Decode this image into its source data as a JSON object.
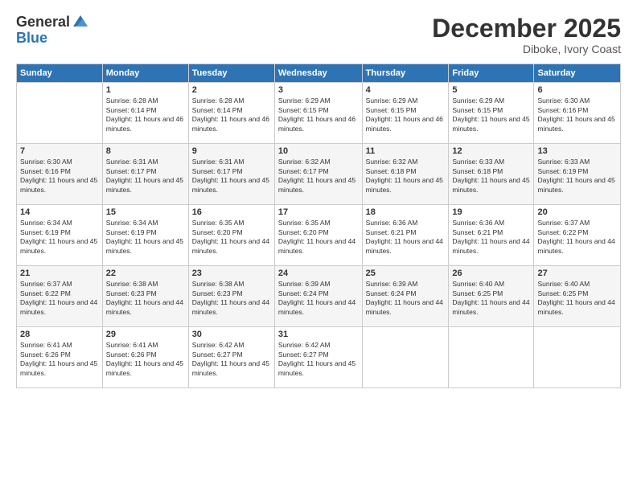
{
  "logo": {
    "general": "General",
    "blue": "Blue"
  },
  "header": {
    "month": "December 2025",
    "location": "Diboke, Ivory Coast"
  },
  "days": [
    "Sunday",
    "Monday",
    "Tuesday",
    "Wednesday",
    "Thursday",
    "Friday",
    "Saturday"
  ],
  "weeks": [
    [
      {
        "date": "",
        "sunrise": "",
        "sunset": "",
        "daylight": ""
      },
      {
        "date": "1",
        "sunrise": "Sunrise: 6:28 AM",
        "sunset": "Sunset: 6:14 PM",
        "daylight": "Daylight: 11 hours and 46 minutes."
      },
      {
        "date": "2",
        "sunrise": "Sunrise: 6:28 AM",
        "sunset": "Sunset: 6:14 PM",
        "daylight": "Daylight: 11 hours and 46 minutes."
      },
      {
        "date": "3",
        "sunrise": "Sunrise: 6:29 AM",
        "sunset": "Sunset: 6:15 PM",
        "daylight": "Daylight: 11 hours and 46 minutes."
      },
      {
        "date": "4",
        "sunrise": "Sunrise: 6:29 AM",
        "sunset": "Sunset: 6:15 PM",
        "daylight": "Daylight: 11 hours and 46 minutes."
      },
      {
        "date": "5",
        "sunrise": "Sunrise: 6:29 AM",
        "sunset": "Sunset: 6:15 PM",
        "daylight": "Daylight: 11 hours and 45 minutes."
      },
      {
        "date": "6",
        "sunrise": "Sunrise: 6:30 AM",
        "sunset": "Sunset: 6:16 PM",
        "daylight": "Daylight: 11 hours and 45 minutes."
      }
    ],
    [
      {
        "date": "7",
        "sunrise": "Sunrise: 6:30 AM",
        "sunset": "Sunset: 6:16 PM",
        "daylight": "Daylight: 11 hours and 45 minutes."
      },
      {
        "date": "8",
        "sunrise": "Sunrise: 6:31 AM",
        "sunset": "Sunset: 6:17 PM",
        "daylight": "Daylight: 11 hours and 45 minutes."
      },
      {
        "date": "9",
        "sunrise": "Sunrise: 6:31 AM",
        "sunset": "Sunset: 6:17 PM",
        "daylight": "Daylight: 11 hours and 45 minutes."
      },
      {
        "date": "10",
        "sunrise": "Sunrise: 6:32 AM",
        "sunset": "Sunset: 6:17 PM",
        "daylight": "Daylight: 11 hours and 45 minutes."
      },
      {
        "date": "11",
        "sunrise": "Sunrise: 6:32 AM",
        "sunset": "Sunset: 6:18 PM",
        "daylight": "Daylight: 11 hours and 45 minutes."
      },
      {
        "date": "12",
        "sunrise": "Sunrise: 6:33 AM",
        "sunset": "Sunset: 6:18 PM",
        "daylight": "Daylight: 11 hours and 45 minutes."
      },
      {
        "date": "13",
        "sunrise": "Sunrise: 6:33 AM",
        "sunset": "Sunset: 6:19 PM",
        "daylight": "Daylight: 11 hours and 45 minutes."
      }
    ],
    [
      {
        "date": "14",
        "sunrise": "Sunrise: 6:34 AM",
        "sunset": "Sunset: 6:19 PM",
        "daylight": "Daylight: 11 hours and 45 minutes."
      },
      {
        "date": "15",
        "sunrise": "Sunrise: 6:34 AM",
        "sunset": "Sunset: 6:19 PM",
        "daylight": "Daylight: 11 hours and 45 minutes."
      },
      {
        "date": "16",
        "sunrise": "Sunrise: 6:35 AM",
        "sunset": "Sunset: 6:20 PM",
        "daylight": "Daylight: 11 hours and 44 minutes."
      },
      {
        "date": "17",
        "sunrise": "Sunrise: 6:35 AM",
        "sunset": "Sunset: 6:20 PM",
        "daylight": "Daylight: 11 hours and 44 minutes."
      },
      {
        "date": "18",
        "sunrise": "Sunrise: 6:36 AM",
        "sunset": "Sunset: 6:21 PM",
        "daylight": "Daylight: 11 hours and 44 minutes."
      },
      {
        "date": "19",
        "sunrise": "Sunrise: 6:36 AM",
        "sunset": "Sunset: 6:21 PM",
        "daylight": "Daylight: 11 hours and 44 minutes."
      },
      {
        "date": "20",
        "sunrise": "Sunrise: 6:37 AM",
        "sunset": "Sunset: 6:22 PM",
        "daylight": "Daylight: 11 hours and 44 minutes."
      }
    ],
    [
      {
        "date": "21",
        "sunrise": "Sunrise: 6:37 AM",
        "sunset": "Sunset: 6:22 PM",
        "daylight": "Daylight: 11 hours and 44 minutes."
      },
      {
        "date": "22",
        "sunrise": "Sunrise: 6:38 AM",
        "sunset": "Sunset: 6:23 PM",
        "daylight": "Daylight: 11 hours and 44 minutes."
      },
      {
        "date": "23",
        "sunrise": "Sunrise: 6:38 AM",
        "sunset": "Sunset: 6:23 PM",
        "daylight": "Daylight: 11 hours and 44 minutes."
      },
      {
        "date": "24",
        "sunrise": "Sunrise: 6:39 AM",
        "sunset": "Sunset: 6:24 PM",
        "daylight": "Daylight: 11 hours and 44 minutes."
      },
      {
        "date": "25",
        "sunrise": "Sunrise: 6:39 AM",
        "sunset": "Sunset: 6:24 PM",
        "daylight": "Daylight: 11 hours and 44 minutes."
      },
      {
        "date": "26",
        "sunrise": "Sunrise: 6:40 AM",
        "sunset": "Sunset: 6:25 PM",
        "daylight": "Daylight: 11 hours and 44 minutes."
      },
      {
        "date": "27",
        "sunrise": "Sunrise: 6:40 AM",
        "sunset": "Sunset: 6:25 PM",
        "daylight": "Daylight: 11 hours and 44 minutes."
      }
    ],
    [
      {
        "date": "28",
        "sunrise": "Sunrise: 6:41 AM",
        "sunset": "Sunset: 6:26 PM",
        "daylight": "Daylight: 11 hours and 45 minutes."
      },
      {
        "date": "29",
        "sunrise": "Sunrise: 6:41 AM",
        "sunset": "Sunset: 6:26 PM",
        "daylight": "Daylight: 11 hours and 45 minutes."
      },
      {
        "date": "30",
        "sunrise": "Sunrise: 6:42 AM",
        "sunset": "Sunset: 6:27 PM",
        "daylight": "Daylight: 11 hours and 45 minutes."
      },
      {
        "date": "31",
        "sunrise": "Sunrise: 6:42 AM",
        "sunset": "Sunset: 6:27 PM",
        "daylight": "Daylight: 11 hours and 45 minutes."
      },
      {
        "date": "",
        "sunrise": "",
        "sunset": "",
        "daylight": ""
      },
      {
        "date": "",
        "sunrise": "",
        "sunset": "",
        "daylight": ""
      },
      {
        "date": "",
        "sunrise": "",
        "sunset": "",
        "daylight": ""
      }
    ]
  ]
}
